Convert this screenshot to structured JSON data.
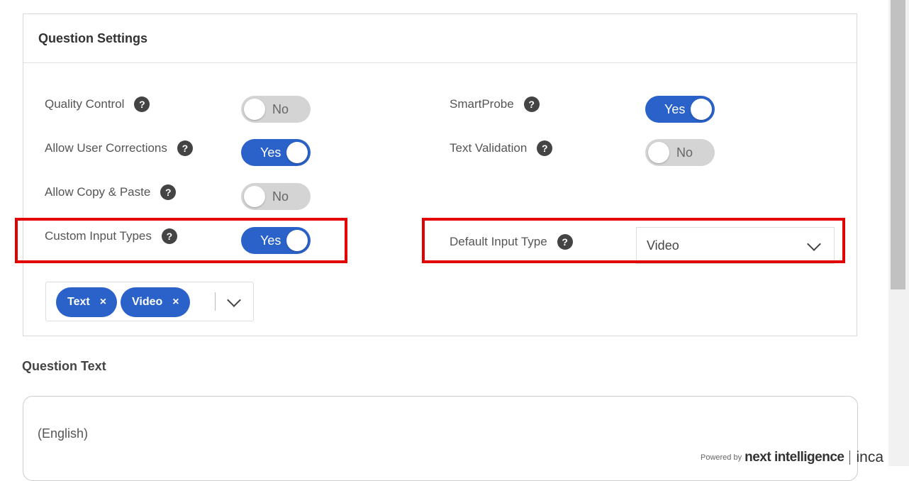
{
  "settings": {
    "title": "Question Settings",
    "quality_control": {
      "label": "Quality Control",
      "value": "No",
      "on": false
    },
    "allow_user_corrections": {
      "label": "Allow User Corrections",
      "value": "Yes",
      "on": true
    },
    "allow_copy_paste": {
      "label": "Allow Copy & Paste",
      "value": "No",
      "on": false
    },
    "custom_input_types": {
      "label": "Custom Input Types",
      "value": "Yes",
      "on": true
    },
    "smartprobe": {
      "label": "SmartProbe",
      "value": "Yes",
      "on": true
    },
    "text_validation": {
      "label": "Text Validation",
      "value": "No",
      "on": false
    },
    "default_input_type": {
      "label": "Default Input Type",
      "value": "Video"
    },
    "input_types": [
      "Text",
      "Video"
    ],
    "chip_remove": "×",
    "help": "?"
  },
  "question_text": {
    "title": "Question Text",
    "language": "(English)"
  },
  "footer": {
    "powered_by": "Powered by",
    "brand": "next intelligence",
    "brand2": "inca"
  },
  "colors": {
    "accent": "#2a62c9",
    "highlight": "#e30000",
    "toggle_off": "#d4d4d4"
  }
}
